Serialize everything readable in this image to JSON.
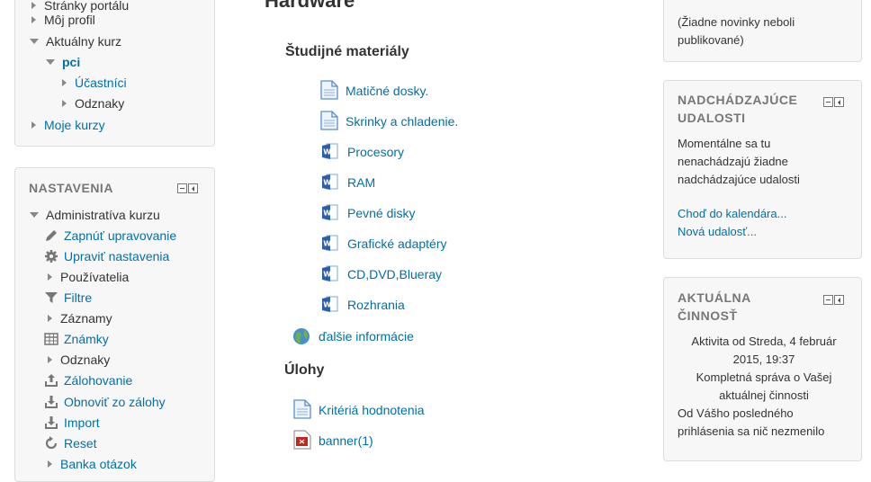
{
  "left_nav": {
    "items": [
      {
        "label": "Stránky portálu",
        "state": "collapsed",
        "link": false
      },
      {
        "label": "Môj profil",
        "state": "collapsed",
        "link": false
      },
      {
        "label": "Aktuálny kurz",
        "state": "expanded",
        "link": false
      },
      {
        "label": "pci",
        "state": "expanded",
        "link": true
      },
      {
        "label": "Účastníci",
        "state": "collapsed",
        "link": true
      },
      {
        "label": "Odznaky",
        "state": "collapsed",
        "link": false
      },
      {
        "label": "Moje kurzy",
        "state": "collapsed",
        "link": true
      }
    ]
  },
  "settings": {
    "title": "NASTAVENIA",
    "items": [
      {
        "label": "Administratíva kurzu",
        "icon": "triangle-down-icon"
      },
      {
        "label": "Zapnúť upravovanie",
        "icon": "pencil-icon"
      },
      {
        "label": "Upraviť nastavenia",
        "icon": "gear-icon"
      },
      {
        "label": "Používatelia",
        "icon": "triangle-right-icon"
      },
      {
        "label": "Filtre",
        "icon": "filter-icon"
      },
      {
        "label": "Záznamy",
        "icon": "triangle-right-icon"
      },
      {
        "label": "Známky",
        "icon": "grades-table-icon"
      },
      {
        "label": "Odznaky",
        "icon": "triangle-right-icon"
      },
      {
        "label": "Zálohovanie",
        "icon": "upload-icon"
      },
      {
        "label": "Obnoviť zo zálohy",
        "icon": "download-icon"
      },
      {
        "label": "Import",
        "icon": "import-icon"
      },
      {
        "label": "Reset",
        "icon": "reset-icon"
      },
      {
        "label": "Banka otázok",
        "icon": "triangle-right-icon"
      }
    ]
  },
  "main": {
    "heading": "Hardware",
    "section1_title": "Študijné materiály",
    "resources": [
      {
        "label": "Matičné dosky.",
        "icon": "page-icon"
      },
      {
        "label": "Skrinky a chladenie.",
        "icon": "page-icon"
      },
      {
        "label": "Procesory",
        "icon": "word-doc-icon"
      },
      {
        "label": "RAM",
        "icon": "word-doc-icon"
      },
      {
        "label": "Pevné disky",
        "icon": "word-doc-icon"
      },
      {
        "label": "Grafické adaptéry",
        "icon": "word-doc-icon"
      },
      {
        "label": "CD,DVD,Blueray",
        "icon": "word-doc-icon"
      },
      {
        "label": "Rozhrania",
        "icon": "word-doc-icon"
      }
    ],
    "url_resource": {
      "label": "ďalšie informácie",
      "icon": "globe-url-icon"
    },
    "section2_title": "Úlohy",
    "tasks": [
      {
        "label": "Kritériá hodnotenia",
        "icon": "page-icon"
      },
      {
        "label": "banner(1)",
        "icon": "pdf-icon"
      }
    ]
  },
  "news": {
    "text": "(Žiadne novinky neboli publikované)"
  },
  "upcoming": {
    "title_line1": "NADCHÁDZAJÚCE",
    "title_line2": "UDALOSTI",
    "text": "Momentálne sa tu nenachádzajú žiadne nadchádzajúce udalosti",
    "link_calendar": "Choď do kalendára...",
    "link_new_event": "Nová udalosť..."
  },
  "activity": {
    "title_line1": "AKTUÁLNA",
    "title_line2": "ČINNOSŤ",
    "since": "Aktivita od Streda, 4 február 2015, 19:37",
    "full_report": "Kompletná správa o Vašej aktuálnej činnosti",
    "nothing": "Od Vášho posledného prihlásenia sa nič nezmenilo"
  }
}
